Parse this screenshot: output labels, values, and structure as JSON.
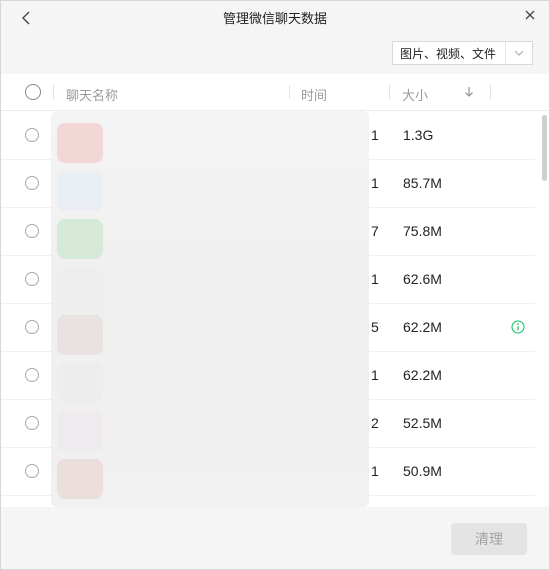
{
  "window": {
    "title": "管理微信聊天数据"
  },
  "filter": {
    "value": "图片、视频、文件"
  },
  "table": {
    "headers": {
      "name": "聊天名称",
      "time": "时间",
      "size": "大小"
    },
    "rows": [
      {
        "time_tail": "1",
        "size": "1.3G",
        "has_info": false
      },
      {
        "time_tail": "1",
        "size": "85.7M",
        "has_info": false
      },
      {
        "time_tail": "7",
        "size": "75.8M",
        "has_info": false
      },
      {
        "time_tail": "1",
        "size": "62.6M",
        "has_info": false
      },
      {
        "time_tail": "5",
        "size": "62.2M",
        "has_info": true
      },
      {
        "time_tail": "1",
        "size": "62.2M",
        "has_info": false
      },
      {
        "time_tail": "2",
        "size": "52.5M",
        "has_info": false
      },
      {
        "time_tail": "1",
        "size": "50.9M",
        "has_info": false
      }
    ]
  },
  "footer": {
    "clear_label": "清理"
  },
  "colors": {
    "info_accent": "#07c160",
    "button_disabled_bg": "#e4e4e4"
  }
}
